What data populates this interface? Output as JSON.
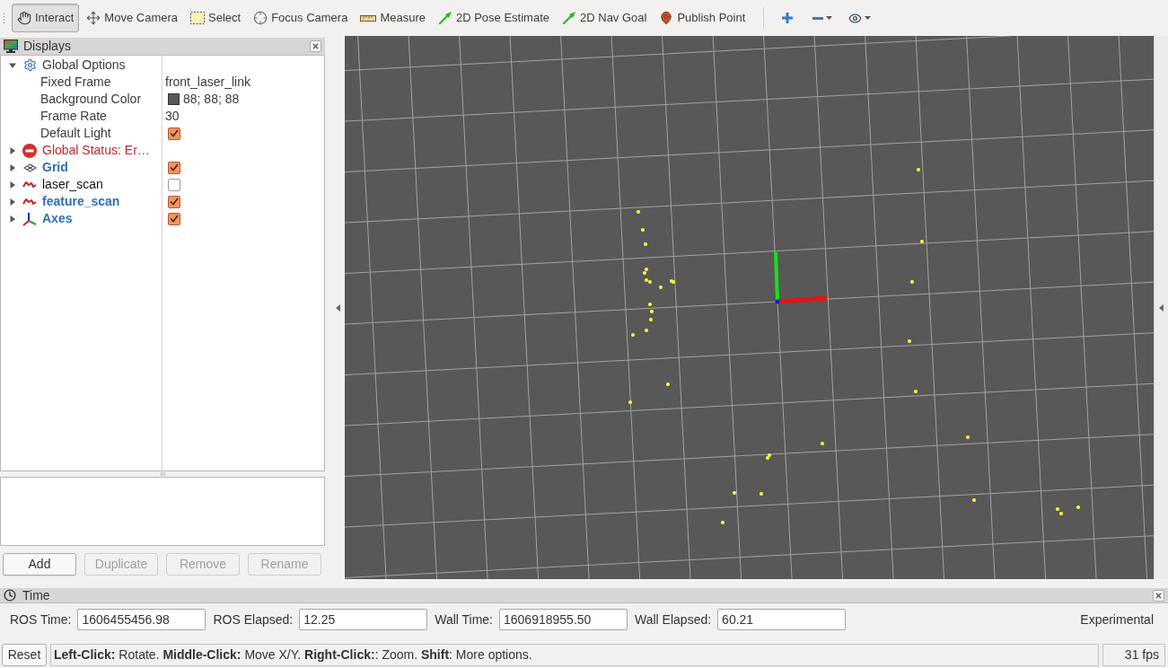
{
  "toolbar": {
    "tools": [
      {
        "label": "Interact",
        "selected": true
      },
      {
        "label": "Move Camera",
        "selected": false
      },
      {
        "label": "Select",
        "selected": false
      },
      {
        "label": "Focus Camera",
        "selected": false
      },
      {
        "label": "Measure",
        "selected": false
      },
      {
        "label": "2D Pose Estimate",
        "selected": false
      },
      {
        "label": "2D Nav Goal",
        "selected": false
      },
      {
        "label": "Publish Point",
        "selected": false
      }
    ]
  },
  "displays": {
    "title": "Displays",
    "items": [
      {
        "kind": "options",
        "label": "Global Options",
        "expanded": true,
        "children": [
          {
            "kind": "text",
            "label": "Fixed Frame",
            "value": "front_laser_link"
          },
          {
            "kind": "color",
            "label": "Background Color",
            "value": "88; 88; 88",
            "color": "#585858"
          },
          {
            "kind": "text",
            "label": "Frame Rate",
            "value": "30"
          },
          {
            "kind": "checkbox",
            "label": "Default Light",
            "checked": true
          }
        ]
      },
      {
        "kind": "error",
        "label": "Global Status: Er…",
        "expanded": false
      },
      {
        "kind": "grid",
        "label": "Grid",
        "expanded": false,
        "checked": true
      },
      {
        "kind": "laser_scan",
        "label": "laser_scan",
        "expanded": false,
        "checked": false
      },
      {
        "kind": "laser_scan",
        "label": "feature_scan",
        "expanded": false,
        "checked": true
      },
      {
        "kind": "axes",
        "label": "Axes",
        "expanded": false,
        "checked": true
      }
    ],
    "buttons": [
      {
        "label": "Add",
        "disabled": false
      },
      {
        "label": "Duplicate",
        "disabled": true
      },
      {
        "label": "Remove",
        "disabled": true
      },
      {
        "label": "Rename",
        "disabled": true
      }
    ]
  },
  "time_panel": {
    "title": "Time",
    "fields": [
      {
        "label": "ROS Time:",
        "value": "1606455456.98"
      },
      {
        "label": "ROS Elapsed:",
        "value": "12.25"
      },
      {
        "label": "Wall Time:",
        "value": "1606918955.50"
      },
      {
        "label": "Wall Elapsed:",
        "value": "60.21"
      }
    ],
    "experimental": "Experimental"
  },
  "status_bar": {
    "reset": "Reset",
    "hint": "**Left-Click:** Rotate. **Middle-Click:** Move X/Y. **Right-Click:**: Zoom. **Shift**: More options.",
    "fps": "31 fps"
  }
}
